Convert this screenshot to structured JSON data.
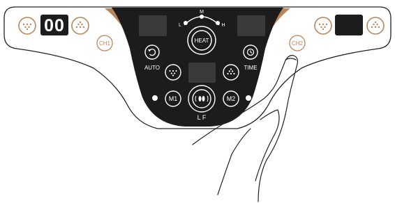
{
  "colors": {
    "panel": "#1c1c1c",
    "gold": "#b8875a",
    "outline": "#222222",
    "white": "#ffffff",
    "display": "#3a3a3a"
  },
  "left_wing": {
    "display_digits": "00",
    "channel_label": "CH1",
    "icons": [
      "massage-dots-down-icon",
      "massage-dots-up-icon"
    ]
  },
  "right_wing": {
    "channel_label": "CH2",
    "icons": [
      "massage-dots-down-icon",
      "massage-dots-up-icon"
    ]
  },
  "center": {
    "heat": {
      "label": "HEAT",
      "level_m": "M",
      "level_l": "L",
      "level_h": "H"
    },
    "auto": {
      "label": "AUTO"
    },
    "time": {
      "label": "TIME"
    },
    "m1": {
      "label": "M1"
    },
    "m2": {
      "label": "M2"
    },
    "lf": {
      "label": "L F"
    }
  },
  "hand": {
    "pointing_to": "CH2"
  }
}
